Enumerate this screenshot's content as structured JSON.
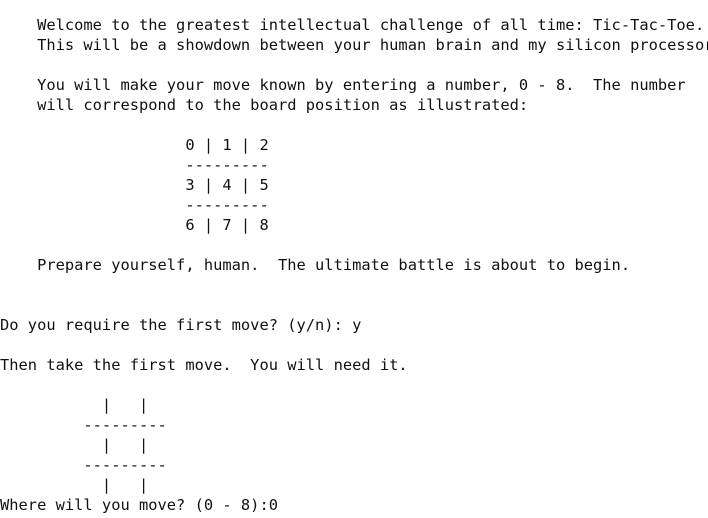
{
  "console": {
    "lines": [
      "    Welcome to the greatest intellectual challenge of all time: Tic-Tac-Toe.",
      "    This will be a showdown between your human brain and my silicon processor.",
      "",
      "    You will make your move known by entering a number, 0 - 8.  The number",
      "    will correspond to the board position as illustrated:",
      "",
      "                    0 | 1 | 2",
      "                    ---------",
      "                    3 | 4 | 5",
      "                    ---------",
      "                    6 | 7 | 8",
      "",
      "    Prepare yourself, human.  The ultimate battle is about to begin.",
      "",
      "",
      "Do you require the first move? (y/n): y",
      "",
      "Then take the first move.  You will need it.",
      "",
      "           |   |",
      "         ---------",
      "           |   |",
      "         ---------",
      "           |   |",
      "Where will you move? (0 - 8):0"
    ]
  }
}
